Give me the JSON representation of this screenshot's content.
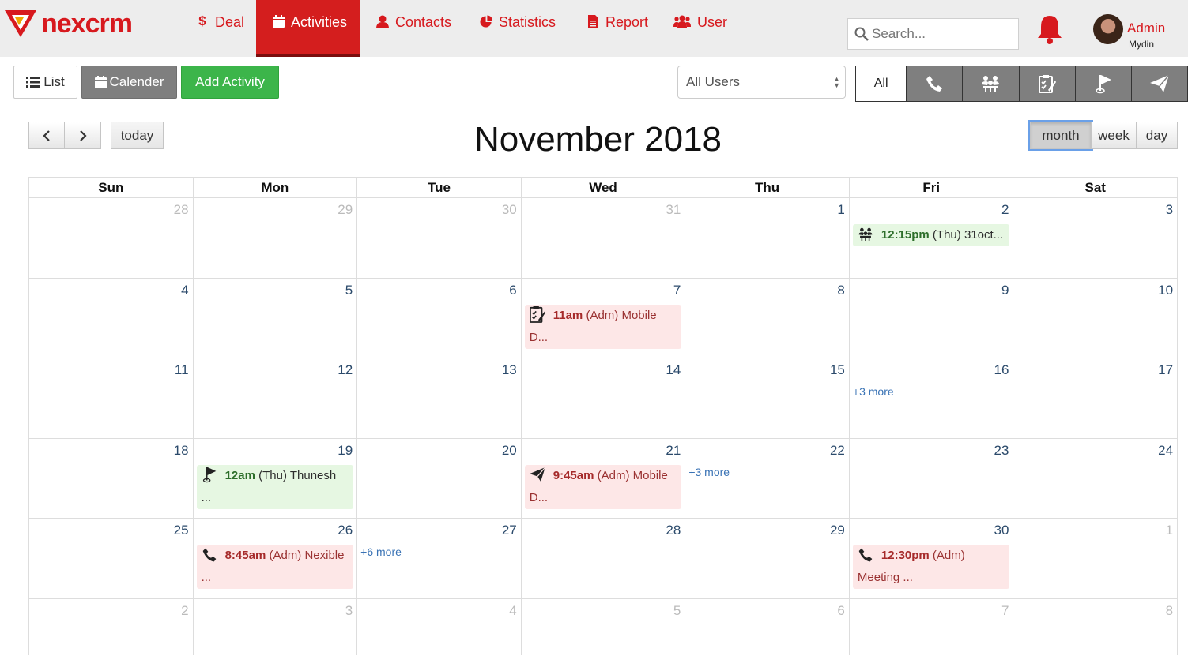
{
  "brand": {
    "name": "nexcrm",
    "color": "#d7191e"
  },
  "nav": {
    "items": [
      {
        "label": "Deal",
        "icon": "dollar-icon"
      },
      {
        "label": "Activities",
        "icon": "calendar-icon",
        "active": true
      },
      {
        "label": "Contacts",
        "icon": "person-icon"
      },
      {
        "label": "Statistics",
        "icon": "pie-chart-icon"
      },
      {
        "label": "Report",
        "icon": "document-icon"
      },
      {
        "label": "User",
        "icon": "users-icon"
      }
    ],
    "search_placeholder": "Search...",
    "user_name": "Admin",
    "user_sub": "Mydin"
  },
  "toolbar": {
    "list_label": "List",
    "calendar_label": "Calender",
    "add_label": "Add Activity",
    "users_select": "All Users",
    "filter_all": "All",
    "filter_icons": [
      "phone-icon",
      "group-meeting-icon",
      "task-icon",
      "deadline-flag-icon",
      "email-send-icon"
    ]
  },
  "calendar": {
    "title": "November 2018",
    "today_label": "today",
    "views": [
      "month",
      "week",
      "day"
    ],
    "active_view": "month",
    "days_of_week": [
      "Sun",
      "Mon",
      "Tue",
      "Wed",
      "Thu",
      "Fri",
      "Sat"
    ],
    "weeks": [
      {
        "days": [
          "28",
          "29",
          "30",
          "31",
          "1",
          "2",
          "3"
        ]
      },
      {
        "days": [
          "4",
          "5",
          "6",
          "7",
          "8",
          "9",
          "10"
        ]
      },
      {
        "days": [
          "11",
          "12",
          "13",
          "14",
          "15",
          "16",
          "17"
        ]
      },
      {
        "days": [
          "18",
          "19",
          "20",
          "21",
          "22",
          "23",
          "24"
        ]
      },
      {
        "days": [
          "25",
          "26",
          "27",
          "28",
          "29",
          "30",
          "1"
        ]
      },
      {
        "days": [
          "2",
          "3",
          "4",
          "5",
          "6",
          "7",
          "8"
        ]
      }
    ],
    "events": {
      "fri_2": {
        "time": "12:15pm",
        "text": " (Thu) 31oct..."
      },
      "wed_7": {
        "time": "11am",
        "text": " (Adm) Mobile D..."
      },
      "mon_19": {
        "time": "12am",
        "text": " (Thu) Thunesh ..."
      },
      "wed_21": {
        "time": "9:45am",
        "text": " (Adm) Mobile D..."
      },
      "mon_26": {
        "time": "8:45am",
        "text": " (Adm) Nexible ..."
      },
      "fri_30": {
        "time": "12:30pm",
        "text": " (Adm) Meeting ..."
      }
    },
    "more_links": {
      "fri_16": "+3 more",
      "thu_22": "+3 more",
      "tue_27": "+6 more"
    }
  }
}
